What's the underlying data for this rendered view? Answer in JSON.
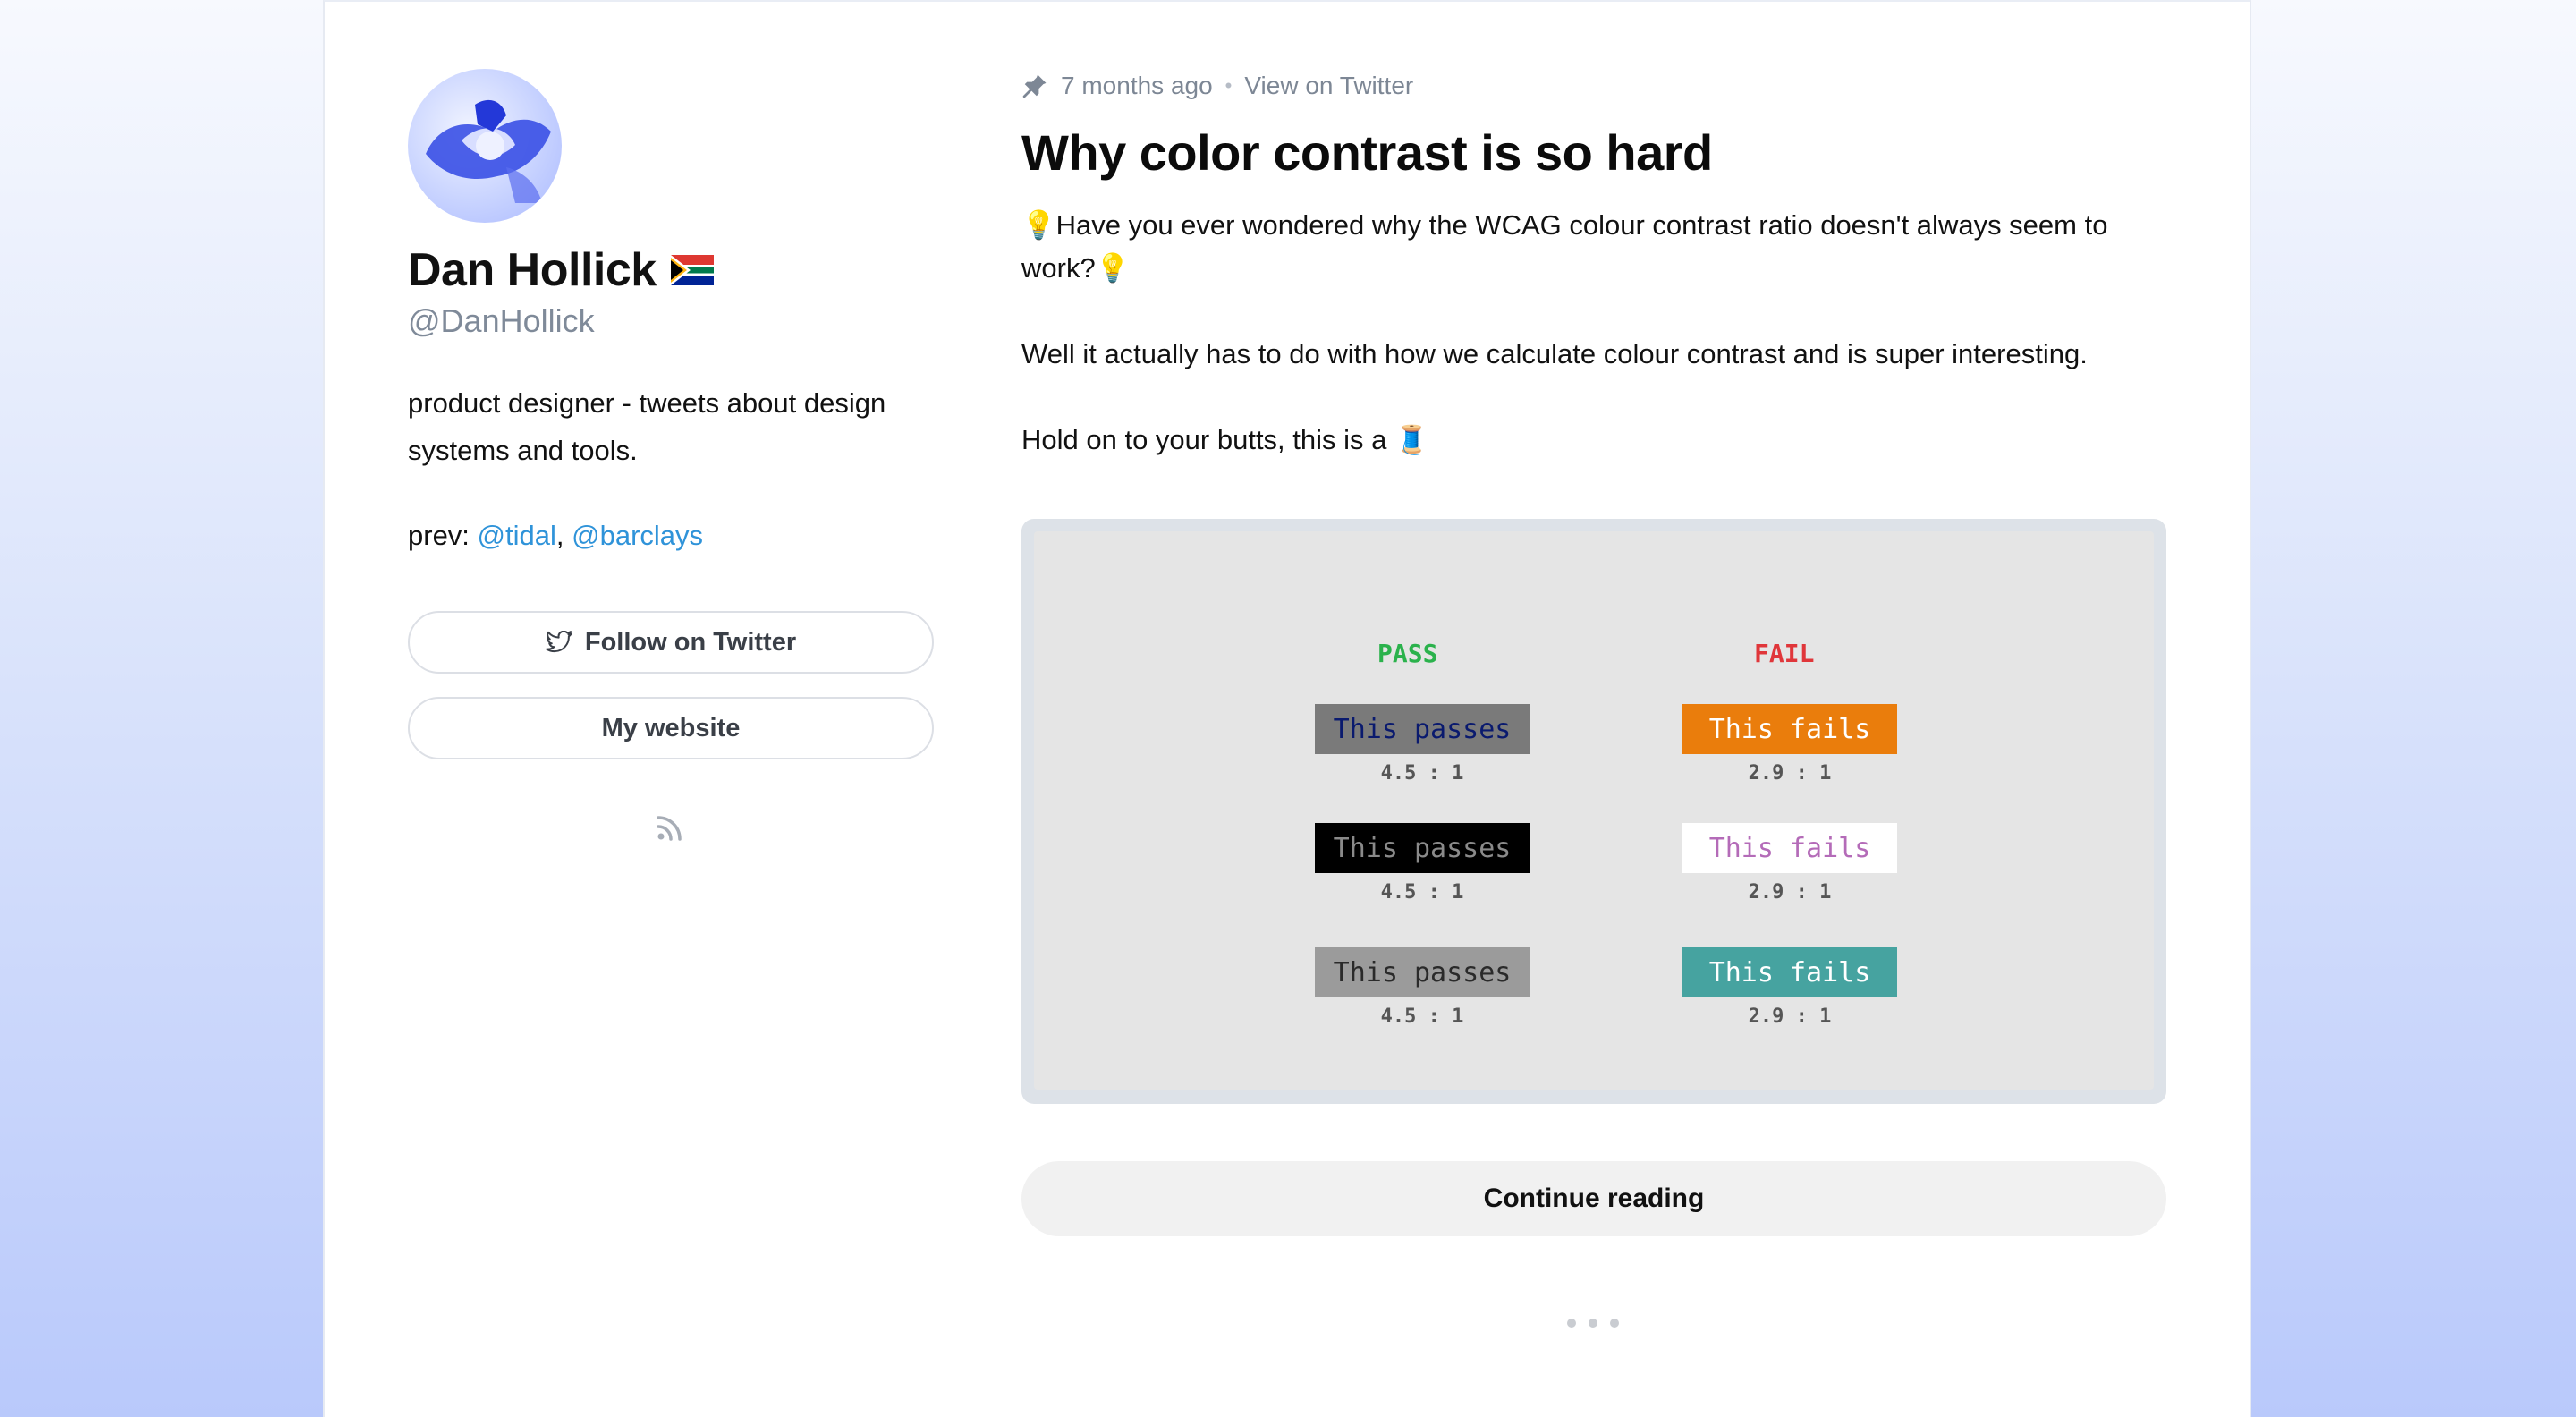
{
  "profile": {
    "name": "Dan Hollick",
    "flag_icon": "south-africa-flag-icon",
    "handle": "@DanHollick",
    "bio": "product designer - tweets about design systems and tools.",
    "prev_label": "prev:",
    "prev_links": [
      "@tidal",
      "@barclays"
    ],
    "prev_separator": ","
  },
  "buttons": {
    "follow_label": "Follow on Twitter",
    "website_label": "My website"
  },
  "post": {
    "time_ago": "7 months ago",
    "separator": "•",
    "view_link": "View on Twitter",
    "title": "Why color contrast is so hard",
    "para1": "💡Have you ever wondered why the WCAG colour contrast ratio doesn't always seem to work?💡",
    "para2": "Well it actually has to do with how we calculate colour contrast and is super interesting.",
    "para3": "Hold on to your butts, this is a 🧵",
    "continue_label": "Continue reading"
  },
  "figure": {
    "pass_heading": "PASS",
    "fail_heading": "FAIL",
    "pass_samples": [
      {
        "text": "This passes",
        "ratio": "4.5 : 1",
        "bg": "#7a7a7a",
        "fg": "#0a1a6e"
      },
      {
        "text": "This passes",
        "ratio": "4.5 : 1",
        "bg": "#000000",
        "fg": "#8a8a8a"
      },
      {
        "text": "This passes",
        "ratio": "4.5 : 1",
        "bg": "#9b9b9b",
        "fg": "#2a2a2a"
      }
    ],
    "fail_samples": [
      {
        "text": "This fails",
        "ratio": "2.9 : 1",
        "bg": "#ea7d0c",
        "fg": "#ffffff"
      },
      {
        "text": "This fails",
        "ratio": "2.9 : 1",
        "bg": "#ffffff",
        "fg": "#b46bb8"
      },
      {
        "text": "This fails",
        "ratio": "2.9 : 1",
        "bg": "#46a3a0",
        "fg": "#ffffff"
      }
    ]
  },
  "colors": {
    "link": "#2f93d9",
    "pass": "#2bb24c",
    "fail": "#e0363a"
  }
}
